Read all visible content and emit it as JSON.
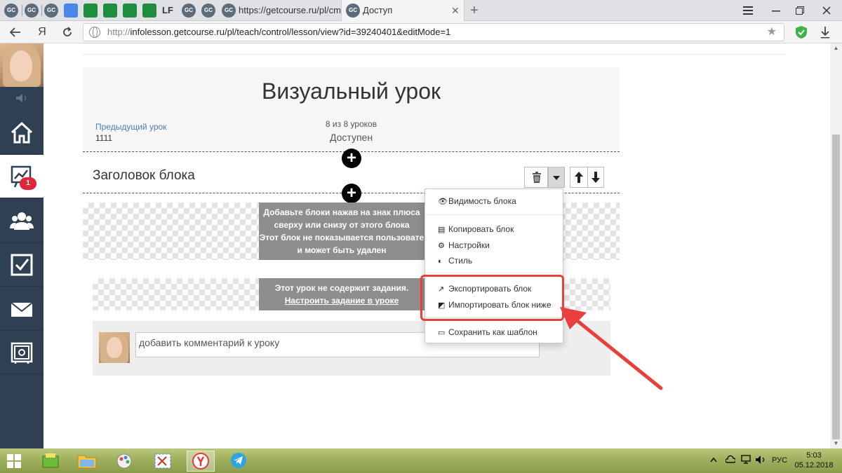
{
  "browser": {
    "tabs": [
      {
        "label": "GC"
      },
      {
        "label": "GC"
      },
      {
        "label": "GC"
      },
      {
        "label": ""
      },
      {
        "label": ""
      },
      {
        "label": ""
      },
      {
        "label": ""
      },
      {
        "label": ""
      },
      {
        "label": "LF"
      },
      {
        "label": "GC"
      },
      {
        "label": "GC"
      }
    ],
    "tab_url_label": "https://getcourse.ru/pl/cms",
    "tab_active_label": "Доступ",
    "close_glyph": "✕",
    "new_tab_glyph": "+",
    "address": {
      "prefix": "http://",
      "host": "infolesson.getcourse.ru",
      "path": "/pl/teach/control/lesson/view?id=39240401&editMode=1"
    },
    "yandex_glyph": "Я"
  },
  "sidebar": {
    "badge": "1",
    "items": [
      "home",
      "stats",
      "users",
      "tasks",
      "mail",
      "safe"
    ]
  },
  "lesson": {
    "title": "Визуальный урок",
    "prev_label": "Предыдущий урок",
    "prev_number": "1111",
    "progress": "8 из 8 уроков",
    "status": "Доступен"
  },
  "block": {
    "title": "Заголовок блока",
    "placeholder_lines": [
      "Добавьте блоки нажав на знак плюса",
      "сверху или снизу от этого блока",
      "Этот блок не показывается пользовате",
      "и может быть удален"
    ]
  },
  "task": {
    "line1": "Этот урок не содержит задания.",
    "link": "Настроить задание в уроке"
  },
  "comment": {
    "placeholder": "добавить комментарий к уроку"
  },
  "dropdown": {
    "visibility": "Видимость блока",
    "copy": "Копировать блок",
    "settings": "Настройки",
    "style": "Стиль",
    "export": "Экспортировать блок",
    "import": "Импортировать блок ниже",
    "save_template": "Сохранить как шаблон"
  },
  "taskbar": {
    "lang": "РУС",
    "time": "5:03",
    "date": "05.12.2018"
  },
  "colors": {
    "sidebar": "#2f4052",
    "highlight": "#e8403d",
    "badge": "#e0283a",
    "link": "#4d7db6"
  }
}
